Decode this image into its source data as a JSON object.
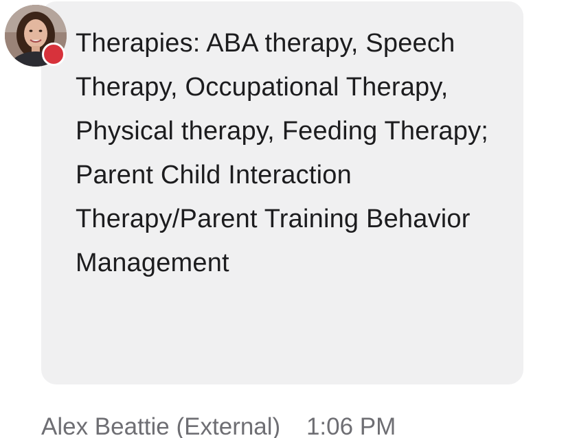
{
  "message": {
    "text": "Therapies: ABA therapy, Speech Therapy, Occupational Therapy, Physical therapy, Feeding Therapy; Parent Child Interaction Therapy/Parent Training Behavior Management",
    "sender": "Alex Beattie (External)",
    "time": "1:06 PM"
  },
  "avatar": {
    "icon": "profile-photo",
    "presence_status_color": "#d7323b"
  },
  "colors": {
    "bubble_background": "#f0f0f1",
    "message_text": "#1c1c1e",
    "meta_text": "#6e6e73"
  }
}
